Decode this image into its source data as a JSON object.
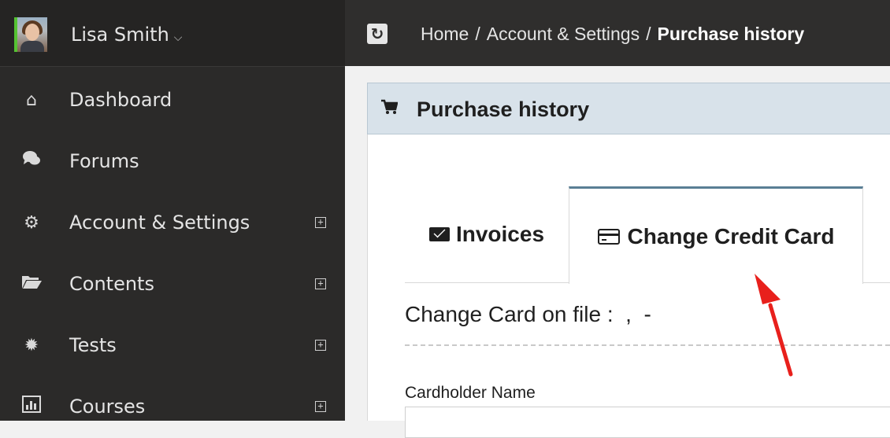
{
  "user": {
    "name": "Lisa Smith",
    "dropdown_icon": "chevron-down-icon"
  },
  "sidebar": {
    "items": [
      {
        "label": "Dashboard",
        "icon": "home-icon",
        "expandable": false
      },
      {
        "label": "Forums",
        "icon": "comments-icon",
        "expandable": false
      },
      {
        "label": "Account & Settings",
        "icon": "gear-icon",
        "expandable": true
      },
      {
        "label": "Contents",
        "icon": "folder-open-icon",
        "expandable": true
      },
      {
        "label": "Tests",
        "icon": "badge-icon",
        "expandable": true
      },
      {
        "label": "Courses",
        "icon": "bar-chart-icon",
        "expandable": true
      }
    ]
  },
  "breadcrumb": {
    "items": [
      "Home",
      "Account & Settings",
      "Purchase history"
    ],
    "separator": "/"
  },
  "panel": {
    "title": "Purchase history"
  },
  "tabs": [
    {
      "label": "Invoices",
      "icon": "envelope-icon",
      "active": false
    },
    {
      "label": "Change Credit Card",
      "icon": "credit-card-icon",
      "active": true
    }
  ],
  "form": {
    "heading": "Change Card on file :  ,  -",
    "cardholder_label": "Cardholder Name",
    "cardholder_value": ""
  },
  "colors": {
    "sidebar_bg": "#2b2a29",
    "active_user_bar": "#55c232",
    "panel_header_bg": "#d8e2ea",
    "active_tab_border": "#5a7f95",
    "annotation_arrow": "#e8201c"
  }
}
